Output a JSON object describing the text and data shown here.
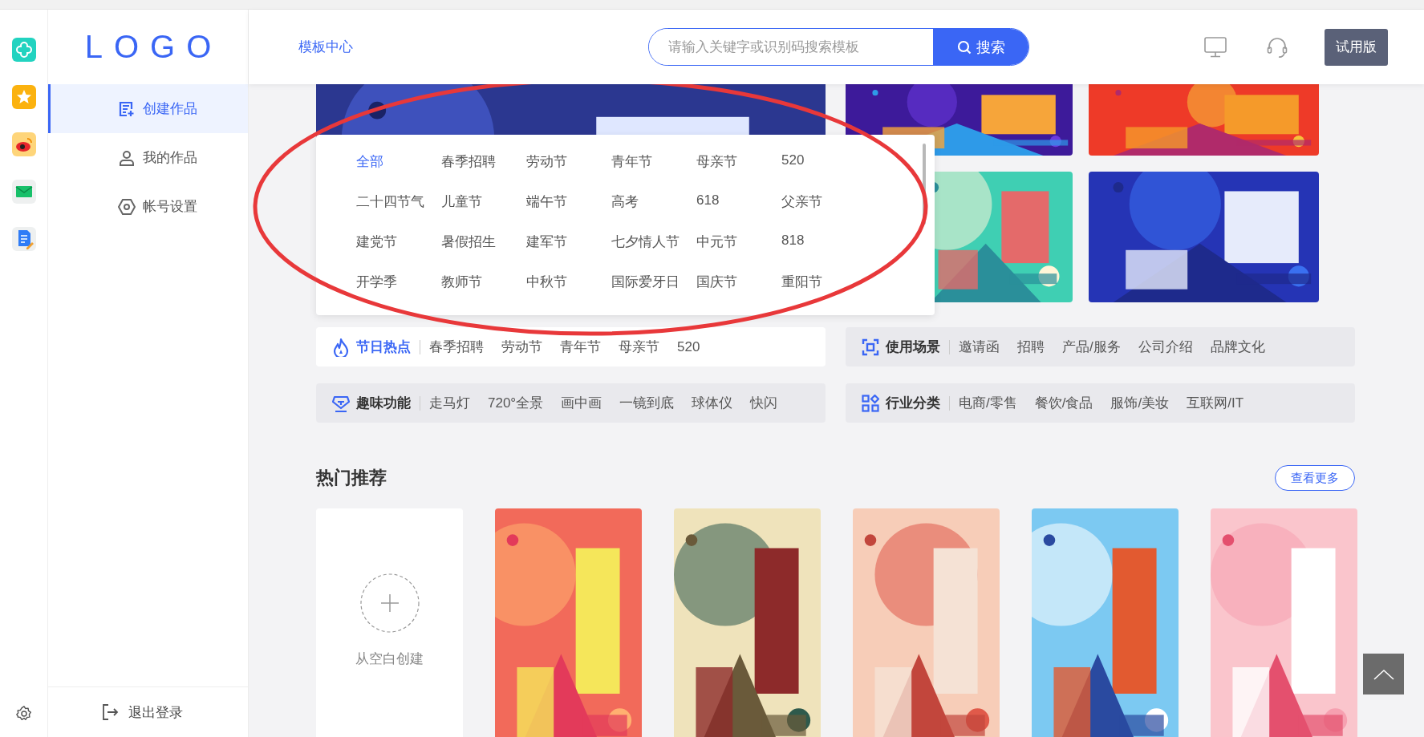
{
  "sidebar": {
    "logo": "LOGO",
    "items": [
      {
        "label": "创建作品",
        "kind": "create",
        "selected": true
      },
      {
        "label": "我的作品",
        "kind": "works",
        "selected": false
      },
      {
        "label": "帐号设置",
        "kind": "account",
        "selected": false
      }
    ],
    "logout": "退出登录"
  },
  "header": {
    "nav_link": "模板中心",
    "search": {
      "placeholder": "请输入关键字或识别码搜索模板",
      "button": "搜索"
    },
    "trial_badge": "试用版"
  },
  "category_dropdown": {
    "items": [
      {
        "label": "全部",
        "selected": true
      },
      {
        "label": "春季招聘",
        "selected": false
      },
      {
        "label": "劳动节",
        "selected": false
      },
      {
        "label": "青年节",
        "selected": false
      },
      {
        "label": "母亲节",
        "selected": false
      },
      {
        "label": "520",
        "selected": false
      },
      {
        "label": "二十四节气",
        "selected": false
      },
      {
        "label": "儿童节",
        "selected": false
      },
      {
        "label": "端午节",
        "selected": false
      },
      {
        "label": "高考",
        "selected": false
      },
      {
        "label": "618",
        "selected": false
      },
      {
        "label": "父亲节",
        "selected": false
      },
      {
        "label": "建党节",
        "selected": false
      },
      {
        "label": "暑假招生",
        "selected": false
      },
      {
        "label": "建军节",
        "selected": false
      },
      {
        "label": "七夕情人节",
        "selected": false
      },
      {
        "label": "中元节",
        "selected": false
      },
      {
        "label": "818",
        "selected": false
      },
      {
        "label": "开学季",
        "selected": false
      },
      {
        "label": "教师节",
        "selected": false
      },
      {
        "label": "中秋节",
        "selected": false
      },
      {
        "label": "国际爱牙日",
        "selected": false
      },
      {
        "label": "国庆节",
        "selected": false
      },
      {
        "label": "重阳节",
        "selected": false
      }
    ]
  },
  "category_bars": [
    {
      "kind": "festival",
      "title": "节日热点",
      "highlighted": true,
      "tags": [
        "春季招聘",
        "劳动节",
        "青年节",
        "母亲节",
        "520"
      ]
    },
    {
      "kind": "scene",
      "title": "使用场景",
      "highlighted": false,
      "tags": [
        "邀请函",
        "招聘",
        "产品/服务",
        "公司介绍",
        "品牌文化"
      ]
    },
    {
      "kind": "fun",
      "title": "趣味功能",
      "highlighted": false,
      "tags": [
        "走马灯",
        "720°全景",
        "画中画",
        "一镜到底",
        "球体仪",
        "快闪"
      ]
    },
    {
      "kind": "industry",
      "title": "行业分类",
      "highlighted": false,
      "tags": [
        "电商/零售",
        "餐饮/食品",
        "服饰/美妆",
        "互联网/IT"
      ]
    }
  ],
  "hot": {
    "title": "热门推荐",
    "more": "查看更多",
    "blank_card": "从空白创建"
  }
}
